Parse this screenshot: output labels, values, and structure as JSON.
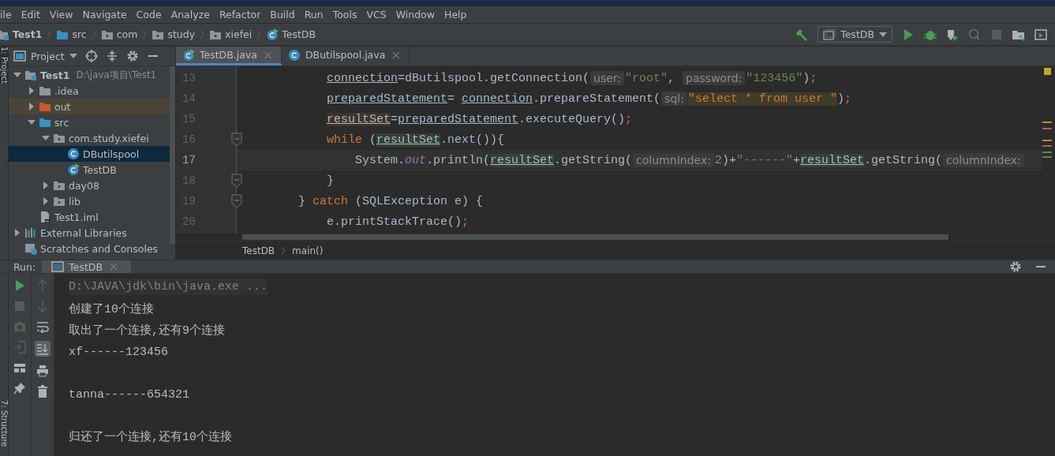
{
  "menu": [
    "ile",
    "Edit",
    "View",
    "Navigate",
    "Code",
    "Analyze",
    "Refactor",
    "Build",
    "Run",
    "Tools",
    "VCS",
    "Window",
    "Help"
  ],
  "breadcrumbs": [
    {
      "label": "Test1",
      "kind": "module"
    },
    {
      "label": "src",
      "kind": "source-folder"
    },
    {
      "label": "com",
      "kind": "package"
    },
    {
      "label": "study",
      "kind": "package"
    },
    {
      "label": "xiefei",
      "kind": "package"
    },
    {
      "label": "TestDB",
      "kind": "class-main"
    }
  ],
  "run_config": "TestDB",
  "side_tabs": [
    "1: Project",
    "7: Structure"
  ],
  "project_panel": {
    "title": "Project",
    "tree": [
      {
        "label": "Test1",
        "kind": "module",
        "note": "D:\\java项目\\Test1",
        "expanded": true,
        "selected": false,
        "children": [
          {
            "label": ".idea",
            "kind": "folder",
            "expanded": false,
            "selected": false
          },
          {
            "label": "out",
            "kind": "excluded-folder",
            "expanded": false,
            "selected": false
          },
          {
            "label": "src",
            "kind": "source-folder",
            "expanded": true,
            "selected": false,
            "children": [
              {
                "label": "com.study.xiefei",
                "kind": "package",
                "expanded": true,
                "selected": false,
                "children": [
                  {
                    "label": "DButilspool",
                    "kind": "class",
                    "selected": true
                  },
                  {
                    "label": "TestDB",
                    "kind": "class-main",
                    "selected": false
                  }
                ]
              },
              {
                "label": "day08",
                "kind": "package",
                "expanded": false,
                "selected": false
              },
              {
                "label": "lib",
                "kind": "package",
                "expanded": false,
                "selected": false
              }
            ]
          },
          {
            "label": "Test1.iml",
            "kind": "iml",
            "selected": false
          }
        ]
      },
      {
        "label": "External Libraries",
        "kind": "libraries",
        "expanded": false,
        "selected": false
      },
      {
        "label": "Scratches and Consoles",
        "kind": "scratches",
        "selected": false
      }
    ]
  },
  "editor_tabs": [
    {
      "label": "TestDB.java",
      "kind": "class-main",
      "selected": true
    },
    {
      "label": "DButilspool.java",
      "kind": "class",
      "selected": false
    }
  ],
  "code": [
    {
      "children": [
        {
          "number": "13",
          "fold": false,
          "current": false,
          "segments": [
            {
              "kind": "var",
              "text": "connection"
            },
            {
              "kind": "plain",
              "text": "=dButilspool.getConnection("
            },
            {
              "kind": "hint",
              "text": "user:"
            },
            {
              "kind": "string",
              "text": "\"root\""
            },
            {
              "kind": "plain",
              "text": ", "
            },
            {
              "kind": "hint",
              "text": "password:"
            },
            {
              "kind": "string",
              "text": "\"123456\""
            },
            {
              "kind": "plain",
              "text": ")"
            },
            {
              "kind": "keyword",
              "text": ";"
            }
          ]
        },
        {
          "number": "14",
          "fold": false,
          "current": false,
          "segments": [
            {
              "kind": "var",
              "text": "preparedStatement"
            },
            {
              "kind": "plain",
              "text": "= "
            },
            {
              "kind": "var",
              "text": "connection"
            },
            {
              "kind": "plain",
              "text": ".prepareStatement("
            },
            {
              "kind": "hint",
              "text": "sql:"
            },
            {
              "kind": "sql",
              "text": "\"select * from user \""
            },
            {
              "kind": "plain",
              "text": ")"
            },
            {
              "kind": "keyword",
              "text": ";"
            }
          ]
        },
        {
          "number": "15",
          "fold": false,
          "current": false,
          "segments": [
            {
              "kind": "var-write",
              "text": "resultSet"
            },
            {
              "kind": "plain",
              "text": "="
            },
            {
              "kind": "var",
              "text": "preparedStatement"
            },
            {
              "kind": "plain",
              "text": ".executeQuery()"
            },
            {
              "kind": "keyword",
              "text": ";"
            }
          ]
        },
        {
          "number": "16",
          "fold": true,
          "current": false,
          "segments": [
            {
              "kind": "keyword",
              "text": "while"
            },
            {
              "kind": "plain",
              "text": " ("
            },
            {
              "kind": "var-read",
              "text": "resultSet"
            },
            {
              "kind": "plain",
              "text": ".next()){"
            }
          ],
          "children": [
            {
              "number": "17",
              "fold": false,
              "current": true,
              "segments": [
                {
                  "kind": "plain",
                  "text": "System."
                },
                {
                  "kind": "static",
                  "text": "out"
                },
                {
                  "kind": "plain",
                  "text": ".println("
                },
                {
                  "kind": "var-read",
                  "text": "resultSet"
                },
                {
                  "kind": "plain",
                  "text": ".getString("
                },
                {
                  "kind": "hint",
                  "text": "columnIndex:"
                },
                {
                  "kind": "number",
                  "text": "2"
                },
                {
                  "kind": "plain",
                  "text": ")+"
                },
                {
                  "kind": "string",
                  "text": "\"------\""
                },
                {
                  "kind": "plain",
                  "text": "+"
                },
                {
                  "kind": "var-read",
                  "text": "resultSet"
                },
                {
                  "kind": "plain",
                  "text": ".getString("
                },
                {
                  "kind": "hint",
                  "text": "columnIndex:"
                }
              ]
            }
          ]
        },
        {
          "number": "18",
          "fold": true,
          "current": false,
          "segments": [
            {
              "kind": "plain",
              "text": "}"
            }
          ]
        }
      ]
    },
    {
      "number": "19",
      "fold": true,
      "current": false,
      "segments": [
        {
          "kind": "plain",
          "text": "} "
        },
        {
          "kind": "keyword",
          "text": "catch"
        },
        {
          "kind": "plain",
          "text": " (SQLException e) {"
        }
      ],
      "children": [
        {
          "number": "20",
          "fold": false,
          "current": false,
          "segments": [
            {
              "kind": "plain",
              "text": "e.printStackTrace()"
            },
            {
              "kind": "keyword",
              "text": ";"
            }
          ]
        }
      ]
    }
  ],
  "editor_breadcrumbs": [
    "TestDB",
    "main()"
  ],
  "run_panel": {
    "label": "Run:",
    "tabs": [
      {
        "label": "TestDB",
        "selected": true
      }
    ],
    "output_blocks": [
      {
        "lines": [
          {
            "text": "D:\\JAVA\\jdk\\bin\\java.exe ...",
            "kind": "command"
          },
          {
            "text": "创建了10个连接",
            "kind": "stdout"
          },
          {
            "text": "取出了一个连接,还有9个连接",
            "kind": "stdout"
          },
          {
            "text": "xf------123456",
            "kind": "stdout"
          }
        ]
      },
      {
        "lines": [
          {
            "text": "tanna------654321",
            "kind": "stdout"
          }
        ]
      },
      {
        "lines": [
          {
            "text": "归还了一个连接,还有10个连接",
            "kind": "stdout"
          }
        ]
      }
    ]
  }
}
